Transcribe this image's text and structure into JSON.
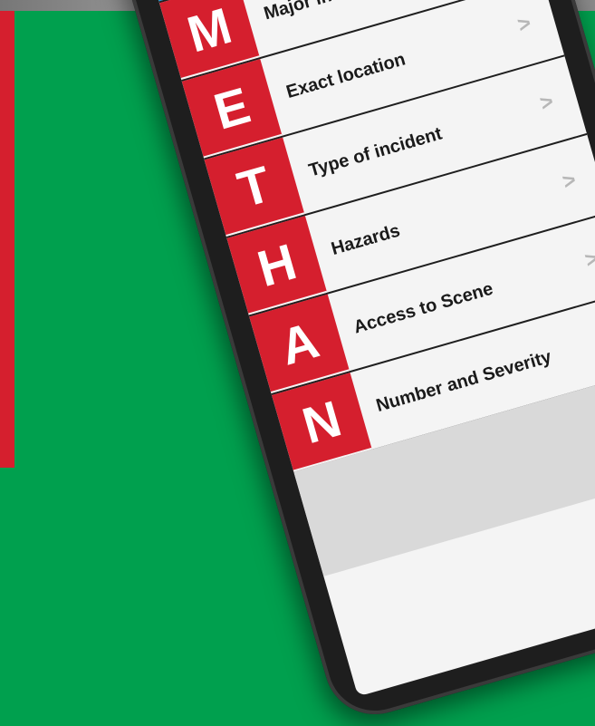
{
  "app": {
    "back_icon_glyph": "<",
    "add_icon_glyph": "+",
    "accent_color": "#1597d9",
    "letter_color": "#d51f2e",
    "background_color": "#00a04e"
  },
  "methane": {
    "items": [
      {
        "letter": "M",
        "label": "Major incident",
        "chevron": ">"
      },
      {
        "letter": "E",
        "label": "Exact location",
        "chevron": ">"
      },
      {
        "letter": "T",
        "label": "Type of incident",
        "chevron": ">"
      },
      {
        "letter": "H",
        "label": "Hazards",
        "chevron": ">"
      },
      {
        "letter": "A",
        "label": "Access to Scene",
        "chevron": ">"
      },
      {
        "letter": "N",
        "label": "Number and Severity",
        "chevron": ""
      }
    ]
  }
}
